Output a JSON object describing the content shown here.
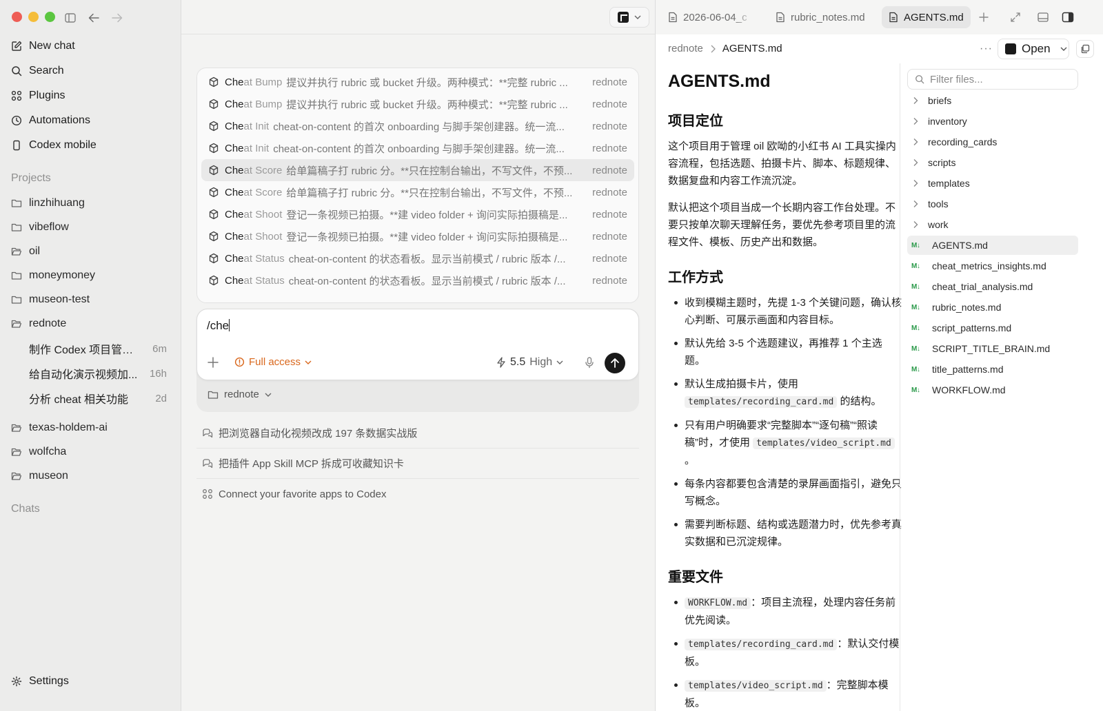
{
  "sidebar": {
    "nav": [
      {
        "label": "New chat",
        "icon": "edit-icon"
      },
      {
        "label": "Search",
        "icon": "search-icon"
      },
      {
        "label": "Plugins",
        "icon": "grid-icon"
      },
      {
        "label": "Automations",
        "icon": "clock-icon"
      },
      {
        "label": "Codex mobile",
        "icon": "phone-icon"
      }
    ],
    "projects_label": "Projects",
    "projects": [
      "linzhihuang",
      "vibeflow",
      "oil",
      "moneymoney",
      "museon-test",
      "rednote"
    ],
    "threads": [
      {
        "title": "制作 Codex 项目管理...",
        "age": "6m"
      },
      {
        "title": "给自动化演示视频加...",
        "age": "16h"
      },
      {
        "title": "分析 cheat 相关功能",
        "age": "2d"
      }
    ],
    "projects_more": [
      "texas-holdem-ai",
      "wolfcha",
      "museon"
    ],
    "chats_label": "Chats",
    "settings_label": "Settings"
  },
  "commands": [
    {
      "prefix": "Che",
      "rest": "at Bump",
      "desc": "提议并执行 rubric 或 bucket 升级。两种模式：**完整 rubric ...",
      "project": "rednote"
    },
    {
      "prefix": "Che",
      "rest": "at Bump",
      "desc": "提议并执行 rubric 或 bucket 升级。两种模式：**完整 rubric ...",
      "project": "rednote"
    },
    {
      "prefix": "Che",
      "rest": "at Init",
      "desc": "cheat-on-content 的首次 onboarding 与脚手架创建器。统一流...",
      "project": "rednote"
    },
    {
      "prefix": "Che",
      "rest": "at Init",
      "desc": "cheat-on-content 的首次 onboarding 与脚手架创建器。统一流...",
      "project": "rednote"
    },
    {
      "prefix": "Che",
      "rest": "at Score",
      "desc": "给单篇稿子打 rubric 分。**只在控制台输出，不写文件，不预...",
      "project": "rednote"
    },
    {
      "prefix": "Che",
      "rest": "at Score",
      "desc": "给单篇稿子打 rubric 分。**只在控制台输出，不写文件，不预...",
      "project": "rednote"
    },
    {
      "prefix": "Che",
      "rest": "at Shoot",
      "desc": "登记一条视频已拍摄。**建 video folder + 询问实际拍摄稿是...",
      "project": "rednote"
    },
    {
      "prefix": "Che",
      "rest": "at Shoot",
      "desc": "登记一条视频已拍摄。**建 video folder + 询问实际拍摄稿是...",
      "project": "rednote"
    },
    {
      "prefix": "Che",
      "rest": "at Status",
      "desc": "cheat-on-content 的状态看板。显示当前模式 / rubric 版本 /...",
      "project": "rednote"
    },
    {
      "prefix": "Che",
      "rest": "at Status",
      "desc": "cheat-on-content 的状态看板。显示当前模式 / rubric 版本 /...",
      "project": "rednote"
    }
  ],
  "selected_command_index": 4,
  "composer": {
    "text": "/che",
    "access": "Full access",
    "model": "5.5",
    "level": "High",
    "folder": "rednote"
  },
  "suggestions": [
    {
      "label": "把浏览器自动化视频改成 197 条数据实战版",
      "icon": "chat-icon"
    },
    {
      "label": "把插件 App Skill MCP 拆成可收藏知识卡",
      "icon": "chat-icon"
    },
    {
      "label": "Connect your favorite apps to Codex",
      "icon": "grid-icon"
    }
  ],
  "tabs": [
    {
      "label": "2026-06-04_c",
      "active": false
    },
    {
      "label": "rubric_notes.md",
      "active": false
    },
    {
      "label": "AGENTS.md",
      "active": true
    }
  ],
  "breadcrumb": {
    "parent": "rednote",
    "current": "AGENTS.md"
  },
  "open_label": "Open",
  "doc": {
    "title": "AGENTS.md",
    "s1_title": "项目定位",
    "s1_p1": "这个项目用于管理 oil 欧呦的小红书 AI 工具实操内容流程，包括选题、拍摄卡片、脚本、标题规律、数据复盘和内容工作流沉淀。",
    "s1_p2": "默认把这个项目当成一个长期内容工作台处理。不要只按单次聊天理解任务，要优先参考项目里的流程文件、模板、历史产出和数据。",
    "s2_title": "工作方式",
    "s2_items": [
      {
        "a": "收到模糊主题时，先提 1-3 个关键问题，确认核心判断、可展示画面和内容目标。"
      },
      {
        "a": "默认先给 3-5 个选题建议，再推荐 1 个主选题。"
      },
      {
        "a": "默认生成拍摄卡片，使用 ",
        "code": "templates/recording_card.md",
        "b": " 的结构。"
      },
      {
        "a": "只有用户明确要求“完整脚本”“逐句稿”“照读稿”时，才使用 ",
        "code": "templates/video_script.md",
        "b": " 。"
      },
      {
        "a": "每条内容都要包含清楚的录屏画面指引，避免只写概念。"
      },
      {
        "a": "需要判断标题、结构或选题潜力时，优先参考真实数据和已沉淀规律。"
      }
    ],
    "s3_title": "重要文件",
    "s3_items": [
      {
        "code": "WORKFLOW.md",
        "b": "：项目主流程，处理内容任务前优先阅读。"
      },
      {
        "code": "templates/recording_card.md",
        "b": "：默认交付模板。"
      },
      {
        "code": "templates/video_script.md",
        "b": "：完整脚本模板。"
      }
    ]
  },
  "files": {
    "filter_placeholder": "Filter files...",
    "folders": [
      "briefs",
      "inventory",
      "recording_cards",
      "scripts",
      "templates",
      "tools",
      "work"
    ],
    "md_files": [
      "AGENTS.md",
      "cheat_metrics_insights.md",
      "cheat_trial_analysis.md",
      "rubric_notes.md",
      "script_patterns.md",
      "SCRIPT_TITLE_BRAIN.md",
      "title_patterns.md",
      "WORKFLOW.md"
    ],
    "selected": "AGENTS.md",
    "md_badge": "M↓"
  },
  "colors": {
    "accent_access": "#d9671c",
    "md_badge": "#2b9a4a"
  }
}
